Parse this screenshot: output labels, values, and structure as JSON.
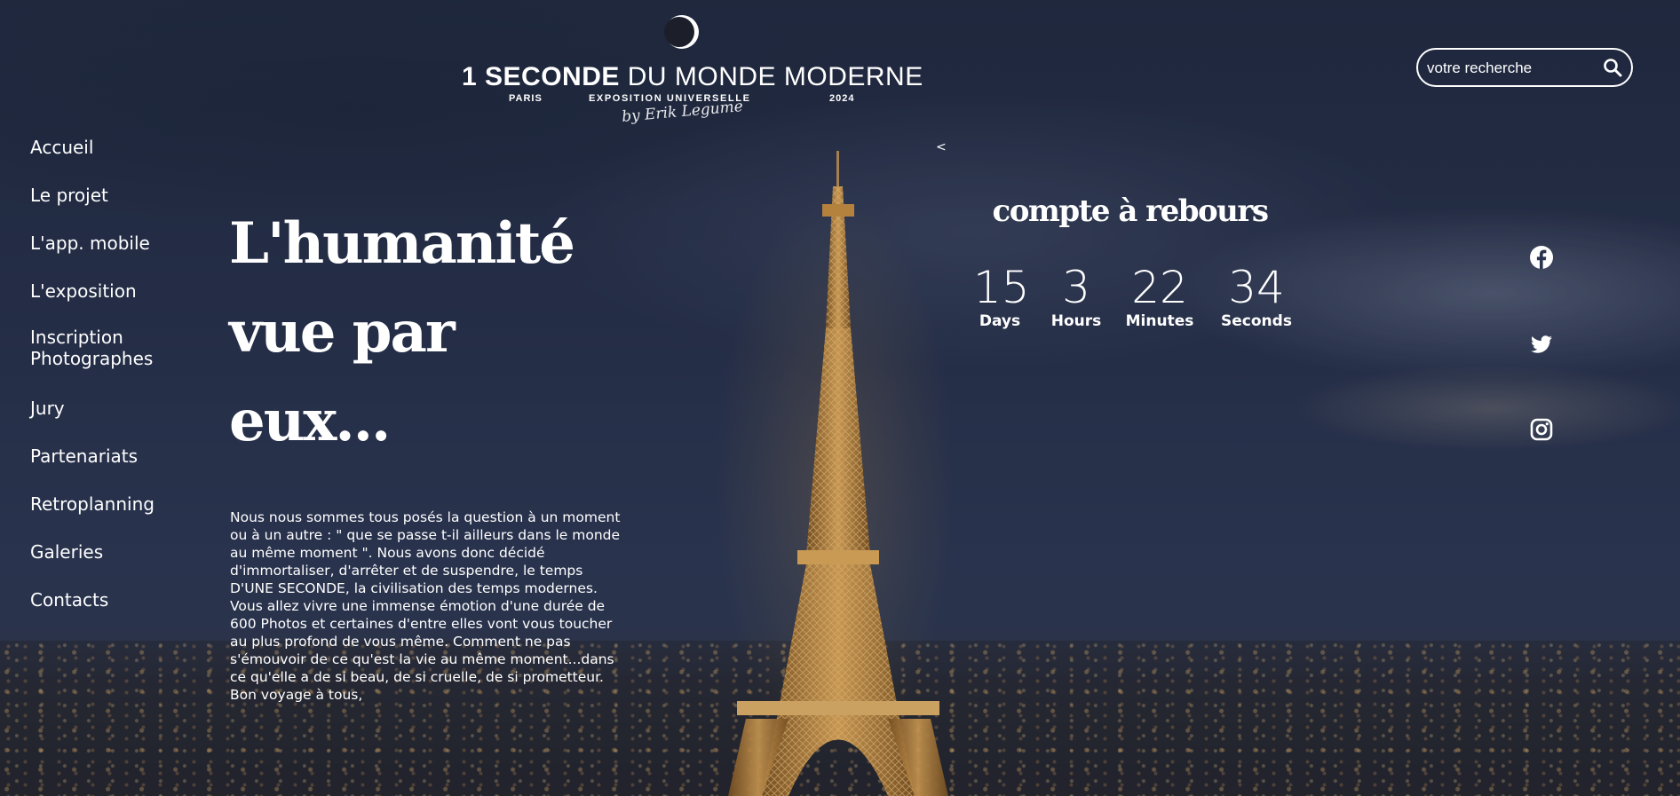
{
  "header": {
    "logo": {
      "title_bold": "1 SECONDE",
      "title_light": " DU MONDE MODERNE",
      "city": "PARIS",
      "subtitle": "EXPOSITION UNIVERSELLE",
      "year": "2024",
      "signature": "by Erik Legume"
    },
    "search": {
      "placeholder": "votre recherche",
      "value": "",
      "icon": "search-icon"
    }
  },
  "nav": {
    "items": [
      {
        "label": "Accueil"
      },
      {
        "label": "Le projet"
      },
      {
        "label": "L'app. mobile"
      },
      {
        "label": "L'exposition"
      },
      {
        "label": "Inscription",
        "label2": "Photographes"
      },
      {
        "label": "Jury"
      },
      {
        "label": "Partenariats"
      },
      {
        "label": "Retroplanning"
      },
      {
        "label": "Galeries"
      },
      {
        "label": "Contacts"
      }
    ]
  },
  "hero": {
    "title_lines": [
      "L'humanité",
      "vue par",
      "eux..."
    ],
    "text": "Nous nous sommes tous posés la question à un moment ou à un autre : \" que se passe t-il ailleurs dans le monde au même moment \". Nous avons donc décidé d'immortaliser, d'arrêter et de suspendre, le temps D'UNE SECONDE, la civilisation des temps modernes. Vous allez vivre une immense émotion d'une durée de 600 Photos et certaines d'entre elles vont vous toucher au plus profond de vous même. Comment ne pas s'émouvoir de ce qu'est la vie au même moment...dans ce qu'elle a de si beau, de si cruelle, de si prometteur. Bon voyage à tous,"
  },
  "slider": {
    "prev_label": "<"
  },
  "countdown": {
    "title": "compte à rebours",
    "units": [
      {
        "value": "15",
        "label": "Days"
      },
      {
        "value": "3",
        "label": "Hours"
      },
      {
        "value": "22",
        "label": "Minutes"
      },
      {
        "value": "34",
        "label": "Seconds"
      }
    ]
  },
  "social": {
    "icons": [
      "facebook-icon",
      "twitter-icon",
      "instagram-icon"
    ]
  },
  "colors": {
    "text": "#ffffff",
    "sky": "#263049",
    "tower_light": "#e8a24a"
  }
}
